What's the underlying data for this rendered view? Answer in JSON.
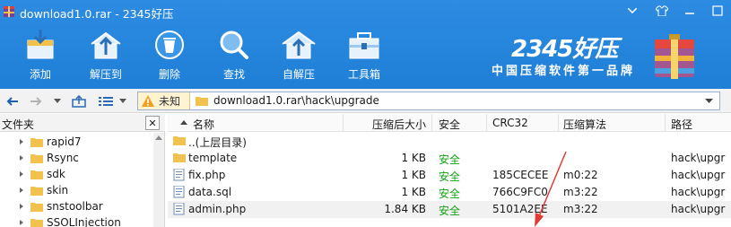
{
  "window": {
    "title": "download1.0.rar - 2345好压"
  },
  "toolbar": {
    "buttons": [
      {
        "label": "添加",
        "icon": "add-icon"
      },
      {
        "label": "解压到",
        "icon": "extract-to-icon"
      },
      {
        "label": "删除",
        "icon": "delete-icon"
      },
      {
        "label": "查找",
        "icon": "search-icon"
      },
      {
        "label": "自解压",
        "icon": "self-extract-icon"
      },
      {
        "label": "工具箱",
        "icon": "toolbox-icon"
      }
    ]
  },
  "brand": {
    "name": "2345好压",
    "slogan": "中国压缩软件第一品牌"
  },
  "address": {
    "status_label": "未知",
    "path": "download1.0.rar\\hack\\upgrade"
  },
  "tree": {
    "title": "文件夹",
    "items": [
      "rapid7",
      "Rsync",
      "sdk",
      "skin",
      "snstoolbar",
      "SSOLInjection"
    ]
  },
  "list": {
    "columns": [
      "名称",
      "压缩后大小",
      "安全",
      "CRC32",
      "压缩算法",
      "路径"
    ],
    "rows": [
      {
        "name": "..(上层目录)",
        "size": "",
        "safe": "",
        "crc": "",
        "method": "",
        "path": "",
        "icon": "parent-folder-icon"
      },
      {
        "name": "template",
        "size": "1 KB",
        "safe": "安全",
        "crc": "",
        "method": "",
        "path": "hack\\upgr",
        "icon": "folder-icon"
      },
      {
        "name": "fix.php",
        "size": "1 KB",
        "safe": "安全",
        "crc": "185CECEE",
        "method": "m0:22",
        "path": "hack\\upgr",
        "icon": "file-icon"
      },
      {
        "name": "data.sql",
        "size": "1 KB",
        "safe": "安全",
        "crc": "766C9FC0",
        "method": "m3:22",
        "path": "hack\\upgr",
        "icon": "file-icon"
      },
      {
        "name": "admin.php",
        "size": "1.84 KB",
        "safe": "安全",
        "crc": "5101A2EE",
        "method": "m3:22",
        "path": "hack\\upgr",
        "icon": "file-icon"
      }
    ]
  },
  "colors": {
    "toolbar_bg": "#1f7fd6",
    "safe_text": "#11a310",
    "annotation_arrow": "#e53935"
  }
}
